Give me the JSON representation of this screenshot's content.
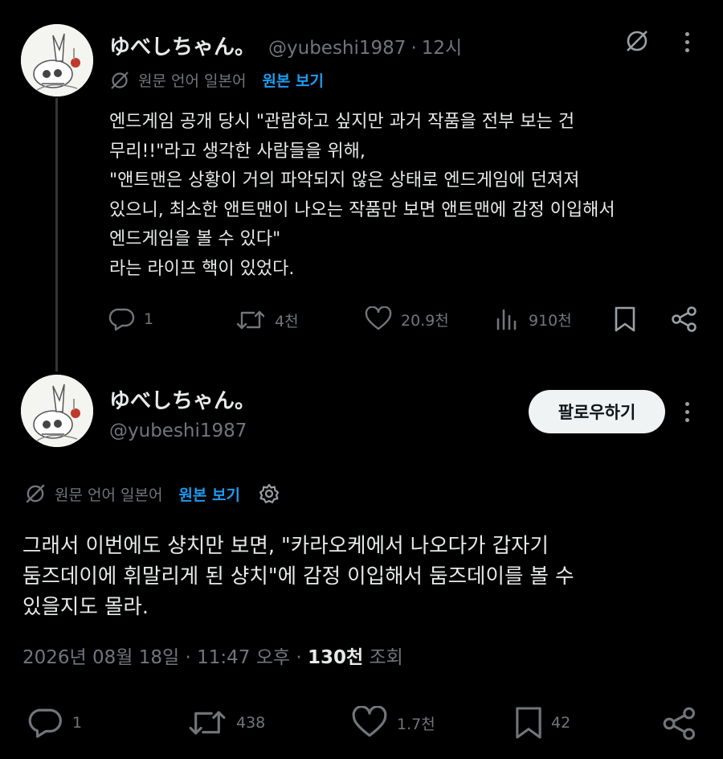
{
  "reply_tweet": {
    "author_name": "ゆべしちゃん。",
    "author_handle": "@yubeshi1987",
    "time_sep": "·",
    "time": "12시",
    "translation": {
      "label": "원문 언어 일본어",
      "show_original": "원본 보기"
    },
    "body": "엔드게임 공개 당시 \"관람하고 싶지만 과거 작품을 전부 보는 건\n무리!!\"라고 생각한 사람들을 위해,\n\"앤트맨은 상황이 거의 파악되지 않은 상태로 엔드게임에 던져져\n있으니, 최소한 앤트맨이 나오는 작품만 보면 앤트맨에 감정 이입해서\n엔드게임을 볼 수 있다\"\n라는 라이프 핵이 있었다.",
    "actions": {
      "replies": "1",
      "retweets": "4천",
      "likes": "20.9천",
      "views": "910천"
    }
  },
  "main_tweet": {
    "author_name": "ゆべしちゃん。",
    "author_handle": "@yubeshi1987",
    "follow_label": "팔로우하기",
    "translation": {
      "label": "원문 언어 일본어",
      "show_original": "원본 보기"
    },
    "body": "그래서 이번에도 샹치만 보면, \"카라오케에서 나오다가 갑자기\n둠즈데이에 휘말리게 된 샹치\"에 감정 이입해서 둠즈데이를 볼 수\n있을지도 몰라.",
    "timestamp": "2026년 08월 18일 · 11:47 오후",
    "views_sep": "·",
    "views_count": "130천",
    "views_label": "조회",
    "actions": {
      "replies": "1",
      "retweets": "438",
      "likes": "1.7천",
      "bookmarks": "42"
    }
  },
  "icons": {
    "translate": "translate-icon",
    "gear": "gear-icon",
    "reply": "reply-icon",
    "retweet": "retweet-icon",
    "like": "heart-icon",
    "views": "views-icon",
    "bookmark": "bookmark-icon",
    "share": "share-icon",
    "more": "more-icon"
  },
  "colors": {
    "background": "#000000",
    "text": "#e7e9ea",
    "muted": "#71767b",
    "link": "#1d9bf0",
    "button": "#eff3f4"
  }
}
